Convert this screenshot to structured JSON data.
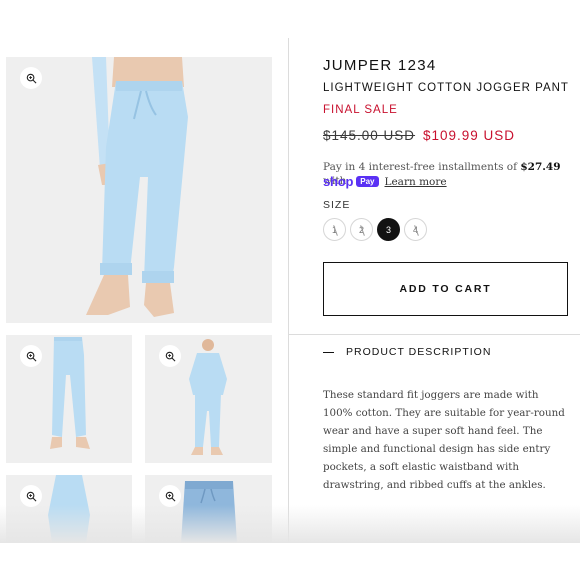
{
  "product": {
    "brand": "JUMPER 1234",
    "title": "LIGHTWEIGHT COTTON JOGGER PANT",
    "sale_label": "FINAL SALE",
    "price_original": "$145.00 USD",
    "price_sale": "$109.99 USD"
  },
  "installments": {
    "prefix": "Pay in 4 interest-free installments of ",
    "amount": "$27.49",
    "suffix": " with",
    "shop_logo": "shop",
    "pay_badge": "Pay",
    "learn_more": "Learn more"
  },
  "size": {
    "label": "SIZE",
    "options": [
      {
        "label": "1",
        "state": "unavailable"
      },
      {
        "label": "2",
        "state": "unavailable"
      },
      {
        "label": "3",
        "state": "selected"
      },
      {
        "label": "4",
        "state": "unavailable"
      }
    ]
  },
  "cart": {
    "button_label": "ADD TO CART"
  },
  "description": {
    "heading": "PRODUCT DESCRIPTION",
    "body": "These standard fit joggers are made with 100% cotton. They are suitable for year-round wear and have a super soft hand feel. The simple and functional design has side entry pockets, a soft elastic waistband with drawstring, and ribbed cuffs at the ankles."
  },
  "gallery": {
    "zoom_icon": "zoom-in-icon",
    "images": [
      {
        "name": "jogger-front-closeup"
      },
      {
        "name": "jogger-front-full"
      },
      {
        "name": "outfit-front-full"
      },
      {
        "name": "outfit-top-crop"
      },
      {
        "name": "jogger-flat-lay"
      }
    ]
  },
  "colors": {
    "accent_red": "#c8102e",
    "shop_pay_purple": "#5a31f4",
    "jogger_blue": "#b9dcf3",
    "text_dark": "#121212"
  }
}
